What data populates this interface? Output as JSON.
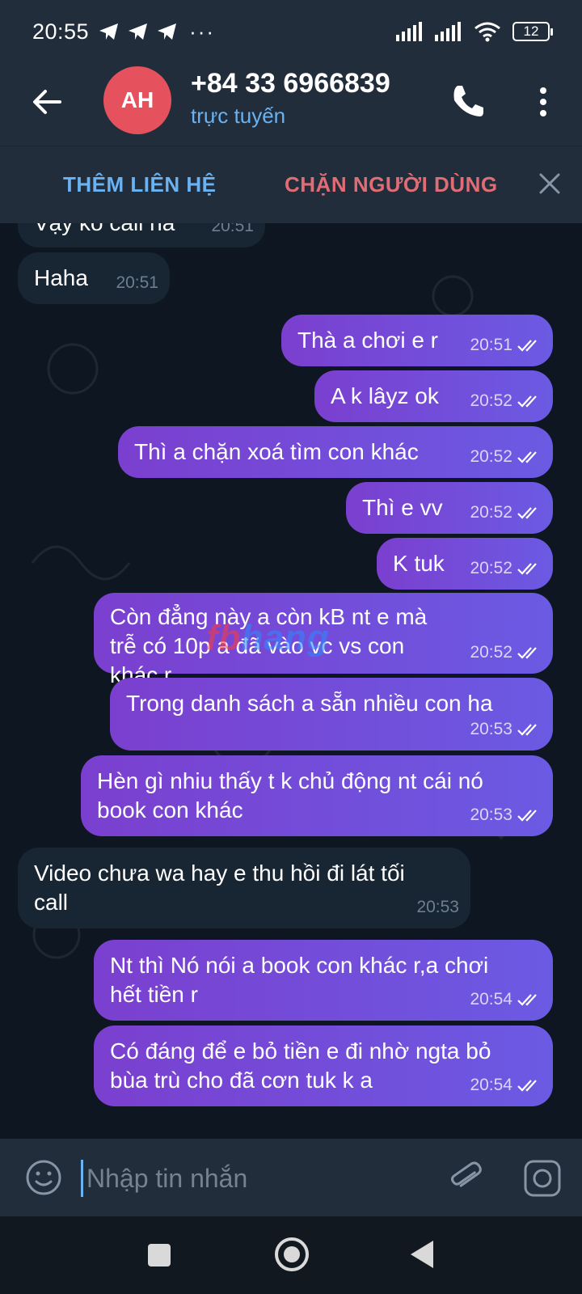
{
  "status_bar": {
    "time": "20:55",
    "dots": "···",
    "battery": "12"
  },
  "header": {
    "avatar_initials": "AH",
    "name": "+84 33 6966839",
    "status": "trực tuyến"
  },
  "action_bar": {
    "add_contact": "THÊM LIÊN HỆ",
    "block_user": "CHẶN NGƯỜI DÙNG"
  },
  "messages": [
    {
      "dir": "in",
      "text": "Vậy ko call hả",
      "time": "20:51"
    },
    {
      "dir": "in",
      "text": "Haha",
      "time": "20:51"
    },
    {
      "dir": "out",
      "text": "Thà a chơi e r",
      "time": "20:51"
    },
    {
      "dir": "out",
      "text": "A k lâyz ok",
      "time": "20:52"
    },
    {
      "dir": "out",
      "text": "Thì a chặn xoá tìm con khác",
      "time": "20:52"
    },
    {
      "dir": "out",
      "text": "Thì e vv",
      "time": "20:52"
    },
    {
      "dir": "out",
      "text": "K tuk",
      "time": "20:52"
    },
    {
      "dir": "out",
      "text": "Còn đẳng này a còn kB nt e mà trễ có 10p a đã vào vc vs con khác r",
      "time": "20:52"
    },
    {
      "dir": "out",
      "text": "Trong danh sách a sẵn nhiều con ha",
      "time": "20:53"
    },
    {
      "dir": "out",
      "text": "Hèn gì nhiu thấy t k chủ động nt cái nó book con khác",
      "time": "20:53"
    },
    {
      "dir": "in",
      "text": "Video chưa wa hay e thu hồi đi lát tối call",
      "time": "20:53"
    },
    {
      "dir": "out",
      "text": "Nt thì Nó nói a book con khác r,a chơi hết tiền r",
      "time": "20:54"
    },
    {
      "dir": "out",
      "text": "Có đáng để e bỏ tiền e đi nhờ ngta bỏ bùa trù cho đã cơn tuk k a",
      "time": "20:54"
    }
  ],
  "watermark": {
    "part1": "fb",
    "part2": "hang"
  },
  "input": {
    "placeholder": "Nhập tin nhắn"
  },
  "colors": {
    "accent": "#6ab2f2",
    "block": "#e06c75",
    "avatar": "#e5525d",
    "outgoing": "#7b3fcf"
  }
}
